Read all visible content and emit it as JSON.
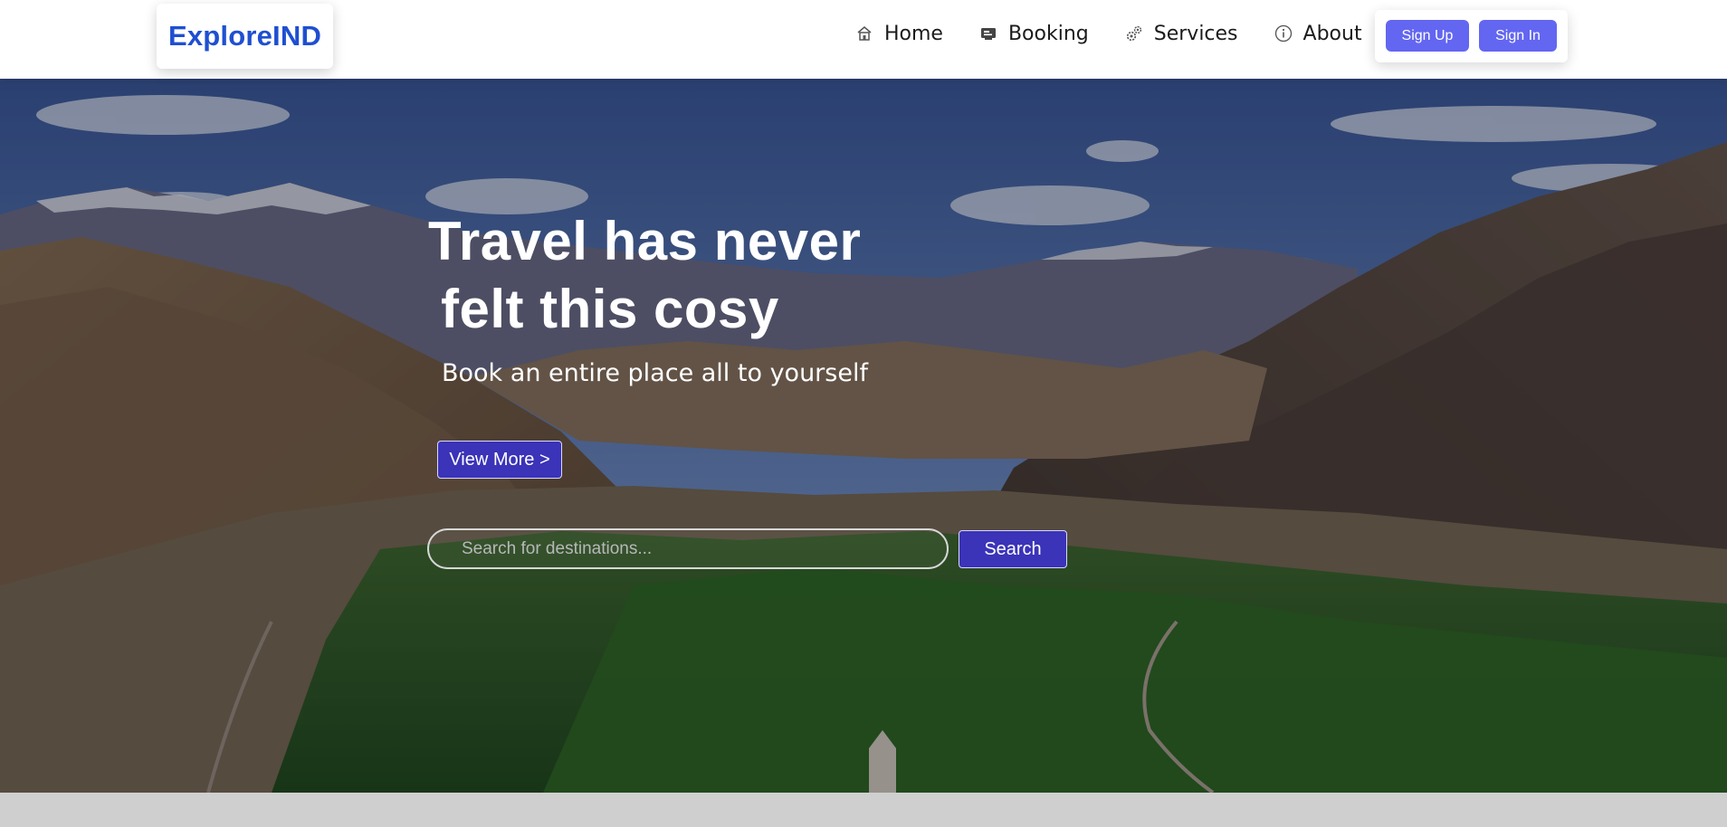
{
  "brand": {
    "name": "ExploreIND",
    "color": "#1f4fd1"
  },
  "nav": {
    "items": [
      {
        "label": "Home",
        "icon": "home-icon"
      },
      {
        "label": "Booking",
        "icon": "booking-icon"
      },
      {
        "label": "Services",
        "icon": "gears-icon"
      },
      {
        "label": "About",
        "icon": "info-icon"
      }
    ]
  },
  "auth": {
    "signup_label": "Sign Up",
    "signin_label": "Sign In",
    "button_color": "#6366f1"
  },
  "hero": {
    "headline_line1": "Travel has never",
    "headline_line2": "felt this cosy",
    "subtitle": "Book an entire place all to yourself",
    "cta_label": "View More >",
    "accent_color": "#3b33b8"
  },
  "search": {
    "placeholder": "Search for destinations...",
    "value": "",
    "button_label": "Search"
  }
}
